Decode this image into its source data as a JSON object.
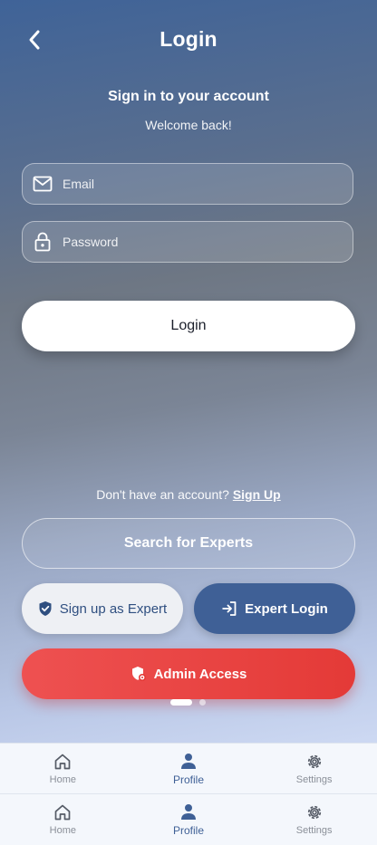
{
  "header": {
    "title": "Login"
  },
  "intro": {
    "heading": "Sign in to your account",
    "welcome": "Welcome back!"
  },
  "form": {
    "email_placeholder": "Email",
    "password_placeholder": "Password",
    "login_label": "Login"
  },
  "signup": {
    "prompt": "Don't have an account? ",
    "link": "Sign Up"
  },
  "actions": {
    "search_label": "Search for Experts",
    "expert_signup_label": "Sign up as Expert",
    "expert_login_label": "Expert Login",
    "admin_label": "Admin Access"
  },
  "pager": {
    "count": 2,
    "active": 1
  },
  "nav": {
    "items": [
      {
        "label": "Home",
        "icon": "home-icon"
      },
      {
        "label": "Profile",
        "icon": "person-icon"
      },
      {
        "label": "Settings",
        "icon": "gear-icon"
      }
    ],
    "active": "Profile"
  },
  "colors": {
    "accent": "#3f6096",
    "danger": "#e43a37",
    "surface": "#f4f7fc"
  }
}
